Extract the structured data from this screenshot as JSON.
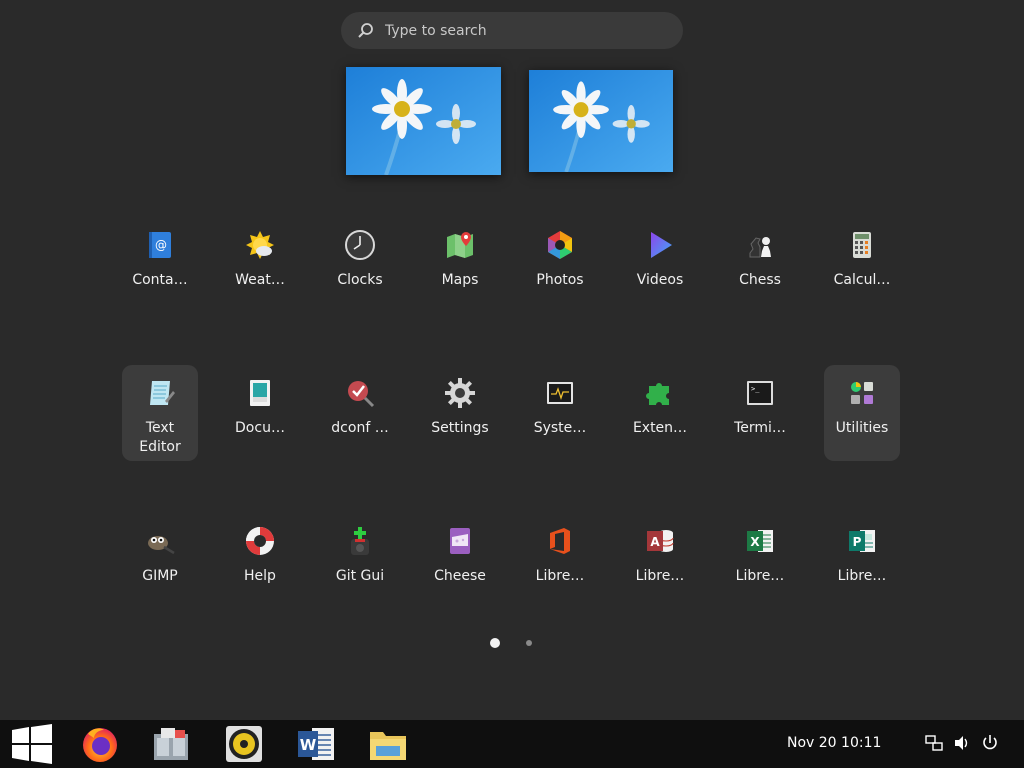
{
  "search": {
    "placeholder": "Type to search",
    "icon": "search-icon"
  },
  "workspaces": [
    {
      "name": "workspace-1",
      "wallpaper": "daisies-on-blue"
    },
    {
      "name": "workspace-2",
      "wallpaper": "daisies-on-blue"
    }
  ],
  "apps": {
    "row1": [
      {
        "label": "Conta…",
        "icon": "contacts-icon"
      },
      {
        "label": "Weat…",
        "icon": "weather-icon"
      },
      {
        "label": "Clocks",
        "icon": "clocks-icon"
      },
      {
        "label": "Maps",
        "icon": "maps-icon"
      },
      {
        "label": "Photos",
        "icon": "photos-icon"
      },
      {
        "label": "Videos",
        "icon": "videos-icon"
      },
      {
        "label": "Chess",
        "icon": "chess-icon"
      },
      {
        "label": "Calcul…",
        "icon": "calculator-icon"
      }
    ],
    "row2": [
      {
        "label": "Text Editor",
        "icon": "text-editor-icon"
      },
      {
        "label": "Docu…",
        "icon": "document-viewer-icon"
      },
      {
        "label": "dconf …",
        "icon": "dconf-editor-icon"
      },
      {
        "label": "Settings",
        "icon": "settings-gear-icon"
      },
      {
        "label": "Syste…",
        "icon": "system-monitor-icon"
      },
      {
        "label": "Exten…",
        "icon": "extensions-puzzle-icon"
      },
      {
        "label": "Termi…",
        "icon": "terminal-icon"
      },
      {
        "label": "Utilities",
        "icon": "utilities-folder-icon"
      }
    ],
    "row3": [
      {
        "label": "GIMP",
        "icon": "gimp-icon"
      },
      {
        "label": "Help",
        "icon": "help-lifebuoy-icon"
      },
      {
        "label": "Git Gui",
        "icon": "git-gui-icon"
      },
      {
        "label": "Cheese",
        "icon": "cheese-icon"
      },
      {
        "label": "Libre…",
        "icon": "office-icon"
      },
      {
        "label": "Libre…",
        "icon": "access-database-icon"
      },
      {
        "label": "Libre…",
        "icon": "excel-spreadsheet-icon"
      },
      {
        "label": "Libre…",
        "icon": "publisher-icon"
      }
    ]
  },
  "pager": {
    "pages": 2,
    "current": 1
  },
  "taskbar": {
    "apps": [
      "windows-start-icon",
      "firefox-icon",
      "file-cabinet-icon",
      "rhythmbox-speaker-icon",
      "word-icon",
      "file-manager-folder-icon"
    ],
    "clock": "Nov 20  10:11",
    "tray": [
      "network-icon",
      "volume-icon",
      "power-icon"
    ]
  },
  "colors": {
    "background": "#2a2a2a",
    "taskbar": "#0f0f0f",
    "highlight": "#3c3c3c",
    "search_bg": "#3a3a3a"
  }
}
